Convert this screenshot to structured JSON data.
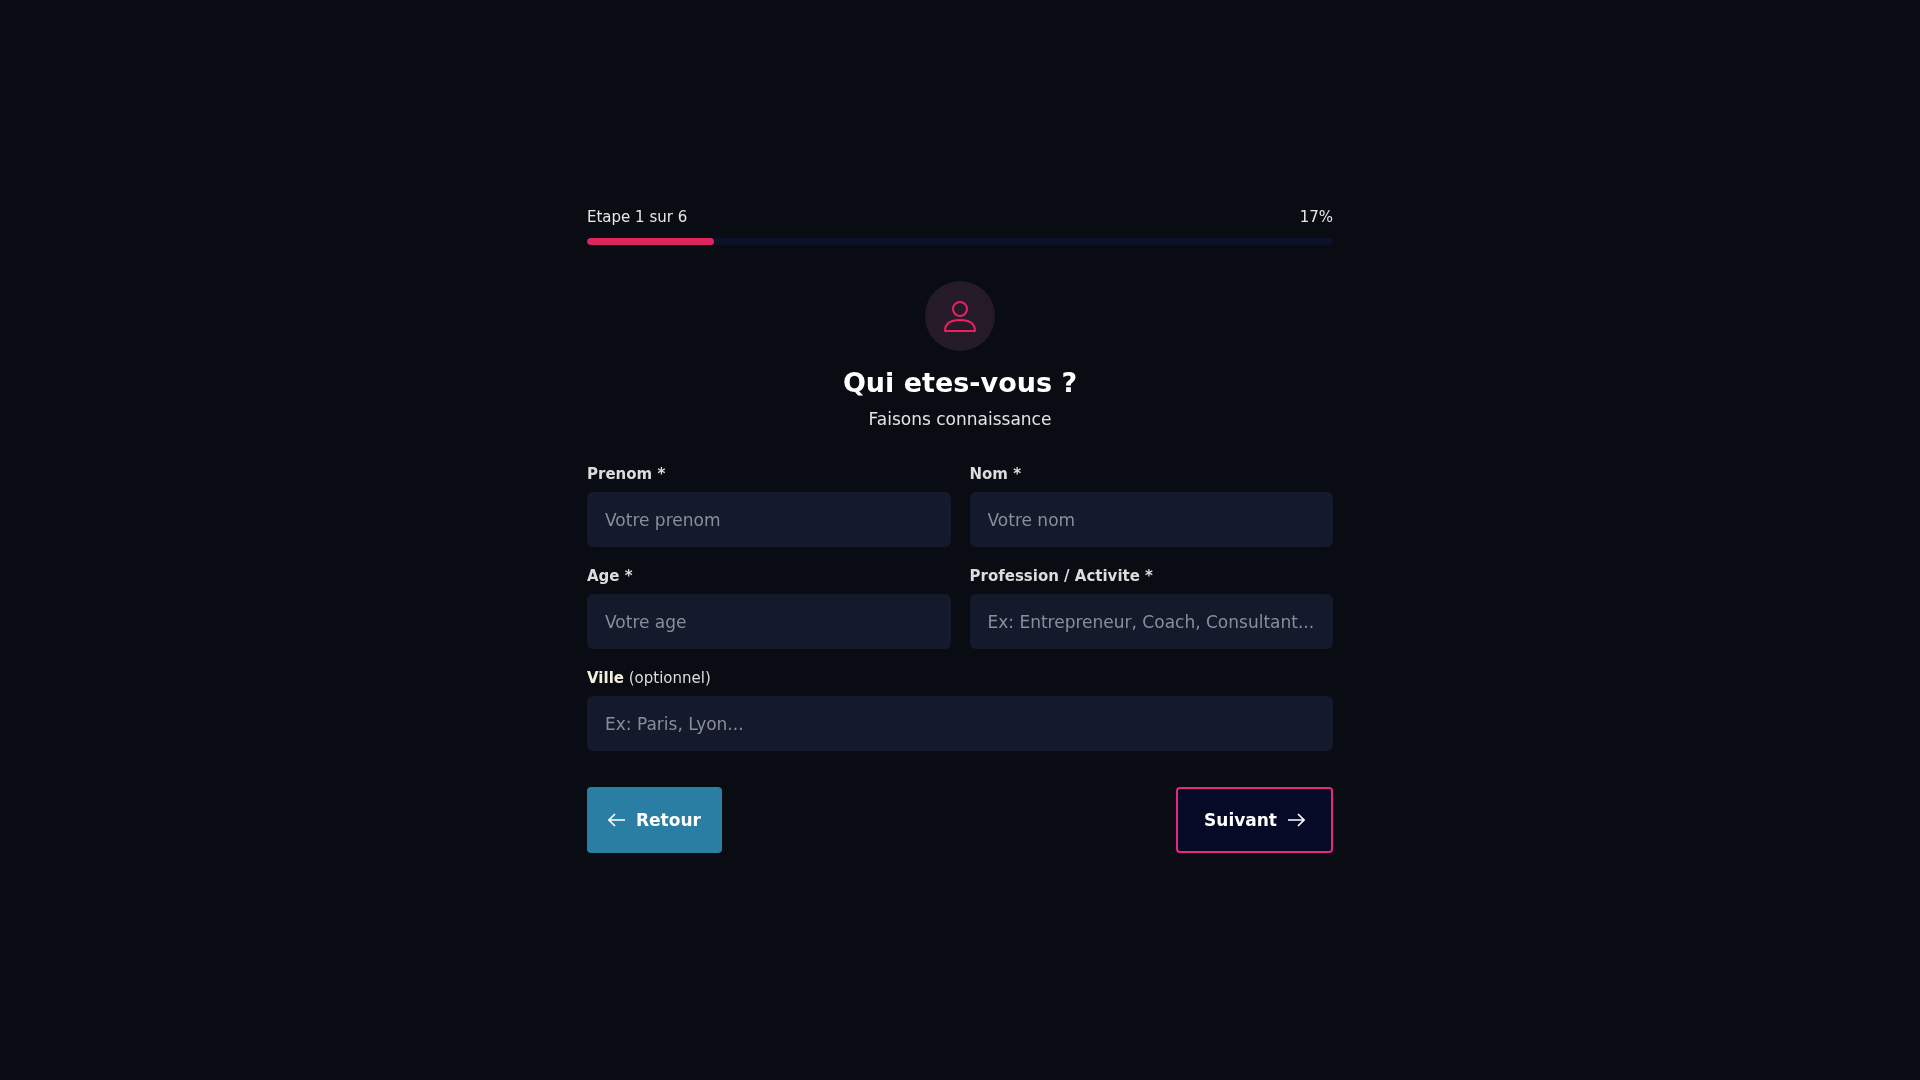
{
  "progress": {
    "step": "Etape 1 sur 6",
    "percent": "17%",
    "level": 0.17
  },
  "header": {
    "title": "Qui etes-vous ?",
    "subtitle": "Faisons connaissance"
  },
  "fields": [
    {
      "label": "Prenom *",
      "placeholder": "Votre prenom",
      "kind": "half"
    },
    {
      "label": "Nom *",
      "placeholder": "Votre nom",
      "kind": "half"
    },
    {
      "label": "Age *",
      "placeholder": "Votre age",
      "kind": "half"
    },
    {
      "label": "Profession / Activite *",
      "placeholder": "Ex: Entrepreneur, Coach, Consultant...",
      "kind": "half"
    },
    {
      "label": "**Ville** (optionnel)",
      "placeholder": "Ex: Paris, Lyon...",
      "kind": "full"
    }
  ],
  "buttons": {
    "back": "Retour",
    "next": "Suivant"
  }
}
